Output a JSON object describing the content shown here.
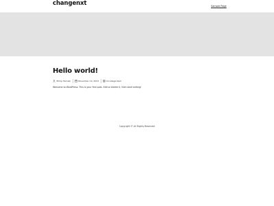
{
  "header": {
    "site_title": "changenxt",
    "nav": [
      {
        "label": "Sample Page"
      }
    ]
  },
  "post": {
    "title": "Hello world!",
    "meta": {
      "author": "Philip Hannah",
      "date": "November 19, 2023",
      "category": "Uncategorized"
    },
    "excerpt": "Welcome to WordPress. This is your first post. Edit or delete it, then start writing!"
  },
  "footer": {
    "copyright": "Copyright © All Rights Reserved"
  },
  "icons": {
    "author": "user-icon",
    "date": "calendar-icon",
    "category": "folder-icon"
  },
  "colors": {
    "hero_background": "#e3e3e3",
    "text": "#1a1a1a"
  }
}
